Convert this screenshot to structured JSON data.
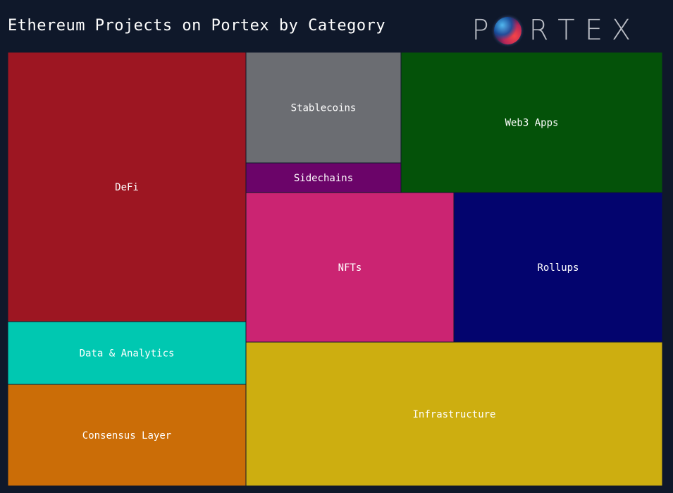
{
  "title": "Ethereum Projects on Portex by Category",
  "logo": {
    "letters": [
      "P",
      "R",
      "T",
      "E",
      "X"
    ],
    "globe_icon": "globe-icon"
  },
  "colors": {
    "background": "#0f182a",
    "DeFi": "#9d1622",
    "Data & Analytics": "#00c8b1",
    "Consensus Layer": "#cb6d07",
    "Stablecoins": "#6b6d72",
    "Sidechains": "#6b0469",
    "Web3 Apps": "#045209",
    "NFTs": "#cb2472",
    "Rollups": "#03046e",
    "Infrastructure": "#cdae10"
  },
  "chart_data": {
    "type": "treemap",
    "title": "Ethereum Projects on Portex by Category",
    "categories": [
      "DeFi",
      "Data & Analytics",
      "Consensus Layer",
      "Stablecoins",
      "Sidechains",
      "Web3 Apps",
      "NFTs",
      "Rollups",
      "Infrastructure"
    ],
    "values": [
      13,
      3,
      5,
      3.5,
      1,
      7.5,
      6.3,
      6.3,
      12
    ]
  }
}
